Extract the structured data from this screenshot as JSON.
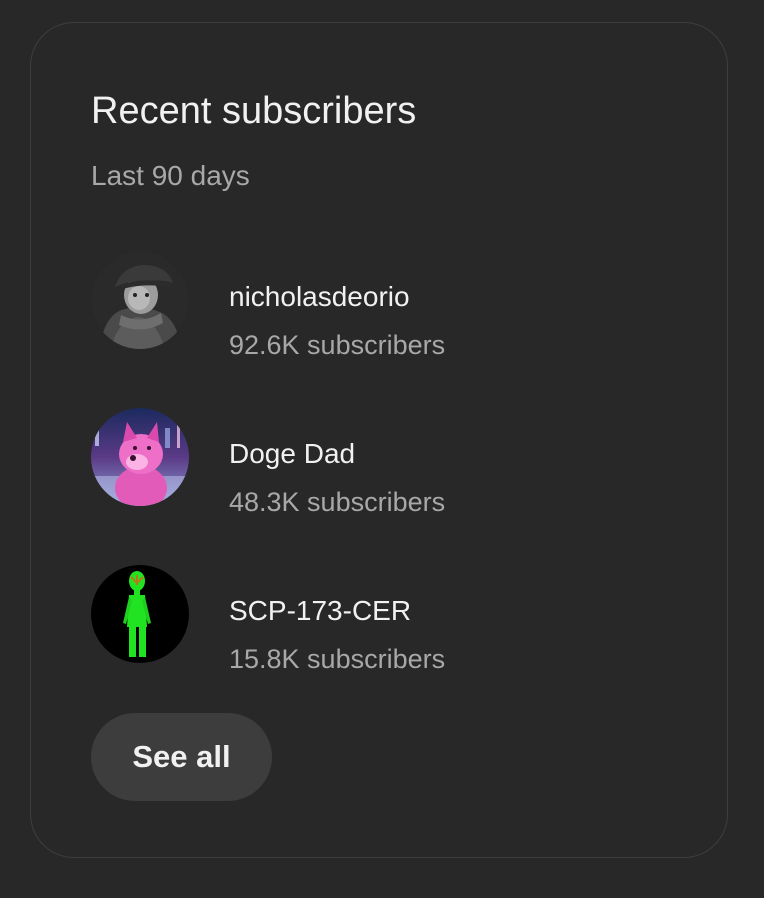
{
  "card": {
    "title": "Recent subscribers",
    "period": "Last 90 days",
    "see_all_label": "See all"
  },
  "subscribers": [
    {
      "name": "nicholasdeorio",
      "count": "92.6K subscribers",
      "avatar": "grayscale-character-avatar"
    },
    {
      "name": "Doge Dad",
      "count": "48.3K subscribers",
      "avatar": "pink-doge-avatar"
    },
    {
      "name": "SCP-173-CER",
      "count": "15.8K subscribers",
      "avatar": "green-figure-avatar"
    }
  ],
  "colors": {
    "background": "#282828",
    "card_border": "#3e3e3e",
    "primary_text": "#f1f1f1",
    "secondary_text": "#a8a8a8",
    "button_bg": "#3d3d3d"
  }
}
